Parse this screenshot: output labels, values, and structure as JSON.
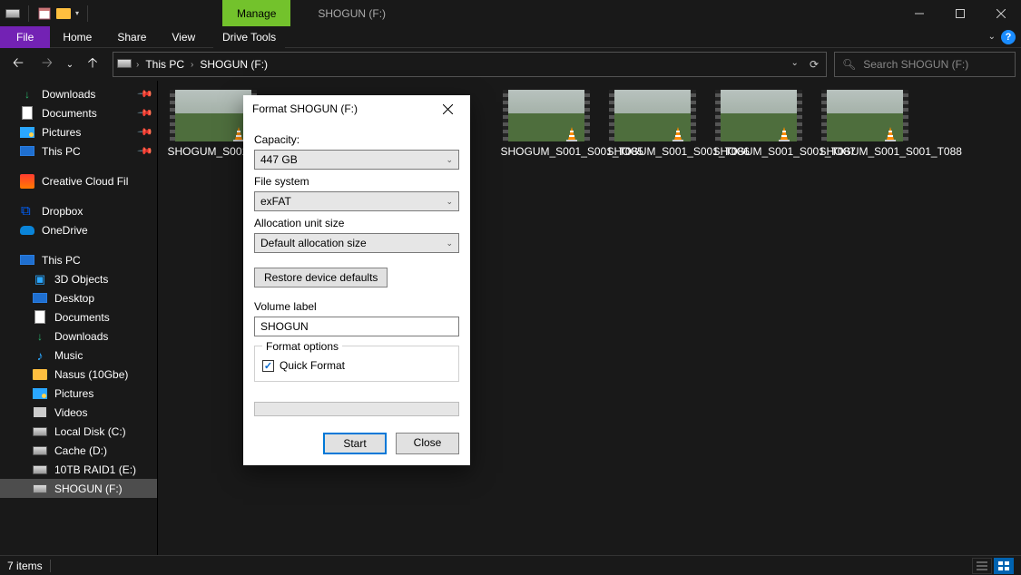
{
  "titlebar": {
    "context_tab": "Manage",
    "title": "SHOGUN (F:)"
  },
  "ribbon": {
    "file": "File",
    "tabs": [
      "Home",
      "Share",
      "View"
    ],
    "context_head": "Drive Tools"
  },
  "nav": {
    "crumbs": [
      "This PC",
      "SHOGUN (F:)"
    ],
    "search_placeholder": "Search SHOGUN (F:)"
  },
  "sidebar": {
    "quick": [
      {
        "label": "Downloads",
        "icon": "download",
        "pinned": true
      },
      {
        "label": "Documents",
        "icon": "doc",
        "pinned": true
      },
      {
        "label": "Pictures",
        "icon": "pic",
        "pinned": true
      },
      {
        "label": "This PC",
        "icon": "pc",
        "pinned": true
      }
    ],
    "extra": [
      {
        "label": "Creative Cloud Fil",
        "icon": "cc"
      }
    ],
    "cloud": [
      {
        "label": "Dropbox",
        "icon": "dbx"
      },
      {
        "label": "OneDrive",
        "icon": "cloud"
      }
    ],
    "thispc": {
      "label": "This PC"
    },
    "thispc_children": [
      {
        "label": "3D Objects",
        "icon": "cube"
      },
      {
        "label": "Desktop",
        "icon": "pc"
      },
      {
        "label": "Documents",
        "icon": "doc"
      },
      {
        "label": "Downloads",
        "icon": "download"
      },
      {
        "label": "Music",
        "icon": "music"
      },
      {
        "label": "Nasus (10Gbe)",
        "icon": "folder"
      },
      {
        "label": "Pictures",
        "icon": "pic"
      },
      {
        "label": "Videos",
        "icon": "vid"
      },
      {
        "label": "Local Disk (C:)",
        "icon": "drive"
      },
      {
        "label": "Cache (D:)",
        "icon": "drive"
      },
      {
        "label": "10TB RAID1 (E:)",
        "icon": "drive"
      },
      {
        "label": "SHOGUN (F:)",
        "icon": "drive",
        "selected": true
      }
    ]
  },
  "files": [
    {
      "name": "SHOGUM_S001_S001_T082"
    },
    {
      "name": "SHOGUM_S001_S001_T085"
    },
    {
      "name": "SHOGUM_S001_S001_T086"
    },
    {
      "name": "SHOGUM_S001_S001_T087"
    },
    {
      "name": "SHOGUM_S001_S001_T088"
    }
  ],
  "dialog": {
    "title": "Format SHOGUN (F:)",
    "capacity_label": "Capacity:",
    "capacity_value": "447 GB",
    "fs_label": "File system",
    "fs_value": "exFAT",
    "aus_label": "Allocation unit size",
    "aus_value": "Default allocation size",
    "restore_btn": "Restore device defaults",
    "vol_label": "Volume label",
    "vol_value": "SHOGUN",
    "options_legend": "Format options",
    "quick_format": "Quick Format",
    "start": "Start",
    "close": "Close"
  },
  "status": {
    "count": "7 items"
  }
}
